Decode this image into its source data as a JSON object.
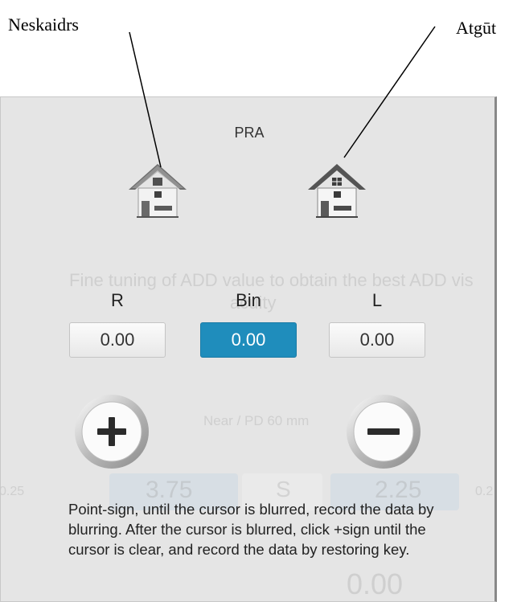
{
  "annotations": {
    "left_label": "Neskaidrs",
    "right_label": "Atgūt"
  },
  "dialog": {
    "title": "PRA",
    "columns": {
      "r_label": "R",
      "bin_label": "Bin",
      "l_label": "L"
    },
    "values": {
      "r_value": "0.00",
      "bin_value": "0.00",
      "l_value": "0.00"
    },
    "selected_value": "Bin",
    "instruction": "Point-sign, until the cursor is blurred, record the data by blurring. After the cursor is blurred, click +sign until the cursor is clear, and record the data by restoring key.",
    "accent_color": "#1f8dbc"
  },
  "background_ghost": {
    "line1": "Fine tuning of ADD value to obtain the best ADD vis",
    "line2": "acuity",
    "near_label": "Near / PD 60 mm",
    "left_value": "3.75",
    "s_label": "S",
    "right_value": "2.25",
    "left_small": "0.25",
    "right_small": "0.2",
    "bottom_value": "0.00"
  }
}
